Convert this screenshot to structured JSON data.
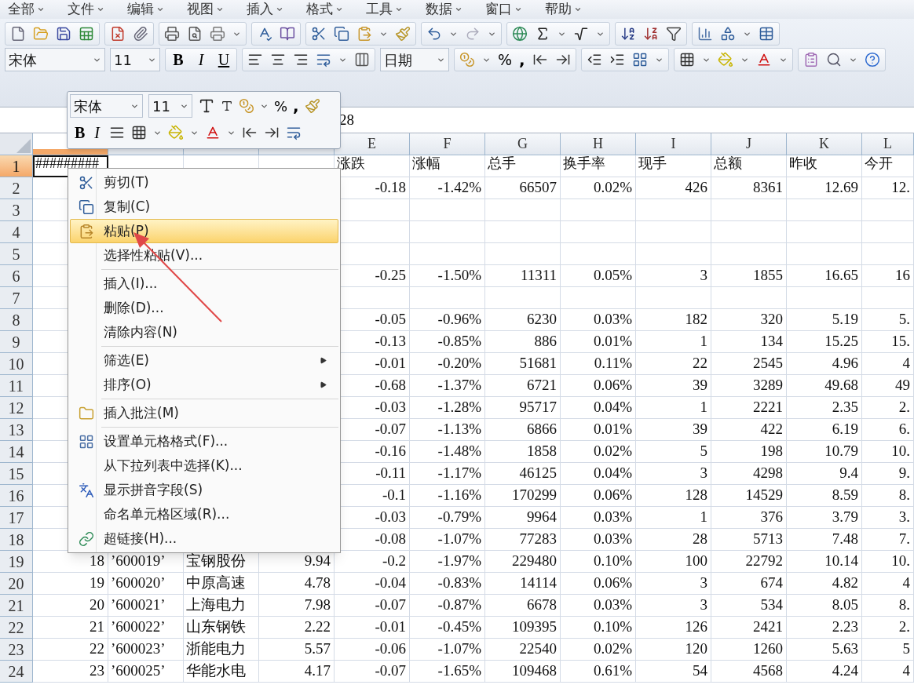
{
  "menu_bar": [
    {
      "label": "全部"
    },
    {
      "label": "文件"
    },
    {
      "label": "编辑"
    },
    {
      "label": "视图"
    },
    {
      "label": "插入"
    },
    {
      "label": "格式"
    },
    {
      "label": "工具"
    },
    {
      "label": "数据"
    },
    {
      "label": "窗口"
    },
    {
      "label": "帮助"
    }
  ],
  "toolbar": {
    "font": "宋体",
    "size": "11",
    "bold": "B",
    "italic": "I",
    "underline": "U",
    "number_format": "日期",
    "percent": "%",
    "comma": ","
  },
  "mini_toolbar": {
    "font": "宋体",
    "size": "11",
    "percent": "%",
    "comma": ",",
    "bold": "B",
    "italic": "I"
  },
  "formula_bar": {
    "value": "28"
  },
  "columns": [
    {
      "selected": true
    },
    {
      "selected": false
    },
    {
      "selected": false
    },
    {
      "selected": false
    },
    {
      "label": "E",
      "selected": false
    },
    {
      "label": "F",
      "selected": false
    },
    {
      "label": "G",
      "selected": false
    },
    {
      "label": "H",
      "selected": false
    },
    {
      "label": "I",
      "selected": false
    },
    {
      "label": "J",
      "selected": false
    },
    {
      "label": "K",
      "selected": false
    },
    {
      "label": "L",
      "selected": false
    }
  ],
  "rows": [
    {
      "number": "1",
      "kind": "header",
      "selected": true,
      "cells": {
        "A": "#########",
        "E": "涨跌",
        "F": "涨幅",
        "G": "总手",
        "H": "换手率",
        "I": "现手",
        "J": "总额",
        "K": "昨收",
        "L": "今开"
      }
    },
    {
      "number": "2",
      "kind": "data",
      "selected": false,
      "cells": {
        "E": "-0.18",
        "F": "-1.42%",
        "G": "66507",
        "H": "0.02%",
        "I": "426",
        "J": "8361",
        "K": "12.69",
        "L": "12."
      }
    },
    {
      "number": "3",
      "kind": "data",
      "selected": false
    },
    {
      "number": "4",
      "kind": "data",
      "selected": false
    },
    {
      "number": "5",
      "kind": "data",
      "selected": false
    },
    {
      "number": "6",
      "kind": "data",
      "selected": false,
      "cells": {
        "E": "-0.25",
        "F": "-1.50%",
        "G": "11311",
        "H": "0.05%",
        "I": "3",
        "J": "1855",
        "K": "16.65",
        "L": "16"
      }
    },
    {
      "number": "7",
      "kind": "data",
      "selected": false
    },
    {
      "number": "8",
      "kind": "data",
      "selected": false,
      "cells": {
        "E": "-0.05",
        "F": "-0.96%",
        "G": "6230",
        "H": "0.03%",
        "I": "182",
        "J": "320",
        "K": "5.19",
        "L": "5."
      }
    },
    {
      "number": "9",
      "kind": "data",
      "selected": false,
      "cells": {
        "E": "-0.13",
        "F": "-0.85%",
        "G": "886",
        "H": "0.01%",
        "I": "1",
        "J": "134",
        "K": "15.25",
        "L": "15."
      }
    },
    {
      "number": "10",
      "kind": "data",
      "selected": false,
      "cells": {
        "E": "-0.01",
        "F": "-0.20%",
        "G": "51681",
        "H": "0.11%",
        "I": "22",
        "J": "2545",
        "K": "4.96",
        "L": "4"
      }
    },
    {
      "number": "11",
      "kind": "data",
      "selected": false,
      "cells": {
        "E": "-0.68",
        "F": "-1.37%",
        "G": "6721",
        "H": "0.06%",
        "I": "39",
        "J": "3289",
        "K": "49.68",
        "L": "49"
      }
    },
    {
      "number": "12",
      "kind": "data",
      "selected": false,
      "cells": {
        "E": "-0.03",
        "F": "-1.28%",
        "G": "95717",
        "H": "0.04%",
        "I": "1",
        "J": "2221",
        "K": "2.35",
        "L": "2."
      }
    },
    {
      "number": "13",
      "kind": "data",
      "selected": false,
      "cells": {
        "E": "-0.07",
        "F": "-1.13%",
        "G": "6866",
        "H": "0.01%",
        "I": "39",
        "J": "422",
        "K": "6.19",
        "L": "6."
      }
    },
    {
      "number": "14",
      "kind": "data",
      "selected": false,
      "cells": {
        "E": "-0.16",
        "F": "-1.48%",
        "G": "1858",
        "H": "0.02%",
        "I": "5",
        "J": "198",
        "K": "10.79",
        "L": "10."
      }
    },
    {
      "number": "15",
      "kind": "data",
      "selected": false,
      "cells": {
        "E": "-0.11",
        "F": "-1.17%",
        "G": "46125",
        "H": "0.04%",
        "I": "3",
        "J": "4298",
        "K": "9.4",
        "L": "9."
      }
    },
    {
      "number": "16",
      "kind": "data",
      "selected": false,
      "cells": {
        "E": "-0.1",
        "F": "-1.16%",
        "G": "170299",
        "H": "0.06%",
        "I": "128",
        "J": "14529",
        "K": "8.59",
        "L": "8."
      }
    },
    {
      "number": "17",
      "kind": "data",
      "selected": false,
      "cells": {
        "E": "-0.03",
        "F": "-0.79%",
        "G": "9964",
        "H": "0.03%",
        "I": "1",
        "J": "376",
        "K": "3.79",
        "L": "3."
      }
    },
    {
      "number": "18",
      "kind": "data",
      "selected": false,
      "cells": {
        "E": "-0.08",
        "F": "-1.07%",
        "G": "77283",
        "H": "0.03%",
        "I": "28",
        "J": "5713",
        "K": "7.48",
        "L": "7."
      }
    },
    {
      "number": "19",
      "kind": "data",
      "selected": false,
      "cells": {
        "A": "18",
        "B": "’600019’",
        "C": "宝钢股份",
        "D": "9.94",
        "E": "-0.2",
        "F": "-1.97%",
        "G": "229480",
        "H": "0.10%",
        "I": "100",
        "J": "22792",
        "K": "10.14",
        "L": "10."
      }
    },
    {
      "number": "20",
      "kind": "data",
      "selected": false,
      "cells": {
        "A": "19",
        "B": "’600020’",
        "C": "中原高速",
        "D": "4.78",
        "E": "-0.04",
        "F": "-0.83%",
        "G": "14114",
        "H": "0.06%",
        "I": "3",
        "J": "674",
        "K": "4.82",
        "L": "4"
      }
    },
    {
      "number": "21",
      "kind": "data",
      "selected": false,
      "cells": {
        "A": "20",
        "B": "’600021’",
        "C": "上海电力",
        "D": "7.98",
        "E": "-0.07",
        "F": "-0.87%",
        "G": "6678",
        "H": "0.03%",
        "I": "3",
        "J": "534",
        "K": "8.05",
        "L": "8."
      }
    },
    {
      "number": "22",
      "kind": "data",
      "selected": false,
      "cells": {
        "A": "21",
        "B": "’600022’",
        "C": "山东钢铁",
        "D": "2.22",
        "E": "-0.01",
        "F": "-0.45%",
        "G": "109395",
        "H": "0.10%",
        "I": "126",
        "J": "2421",
        "K": "2.23",
        "L": "2."
      }
    },
    {
      "number": "23",
      "kind": "data",
      "selected": false,
      "cells": {
        "A": "22",
        "B": "’600023’",
        "C": "浙能电力",
        "D": "5.57",
        "E": "-0.06",
        "F": "-1.07%",
        "G": "22540",
        "H": "0.02%",
        "I": "120",
        "J": "1260",
        "K": "5.63",
        "L": "5"
      }
    },
    {
      "number": "24",
      "kind": "data",
      "selected": false,
      "cells": {
        "A": "23",
        "B": "’600025’",
        "C": "华能水电",
        "D": "4.17",
        "E": "-0.07",
        "F": "-1.65%",
        "G": "109468",
        "H": "0.61%",
        "I": "54",
        "J": "4568",
        "K": "4.24",
        "L": "4"
      }
    }
  ],
  "context_menu": [
    {
      "kind": "item",
      "label": "剪切(T)",
      "selected": false
    },
    {
      "kind": "item",
      "label": "复制(C)",
      "selected": false
    },
    {
      "kind": "item",
      "label": "粘贴(P)",
      "selected": true
    },
    {
      "kind": "item",
      "label": "选择性粘贴(V)...",
      "selected": false
    },
    {
      "kind": "separator"
    },
    {
      "kind": "item",
      "label": "插入(I)...",
      "selected": false
    },
    {
      "kind": "item",
      "label": "删除(D)...",
      "selected": false
    },
    {
      "kind": "item",
      "label": "清除内容(N)",
      "selected": false
    },
    {
      "kind": "separator"
    },
    {
      "kind": "submenu",
      "label": "筛选(E)",
      "selected": false
    },
    {
      "kind": "submenu",
      "label": "排序(O)",
      "selected": false
    },
    {
      "kind": "separator"
    },
    {
      "kind": "item",
      "label": "插入批注(M)",
      "selected": false
    },
    {
      "kind": "separator"
    },
    {
      "kind": "item",
      "label": "设置单元格格式(F)...",
      "selected": false
    },
    {
      "kind": "item",
      "label": "从下拉列表中选择(K)...",
      "selected": false
    },
    {
      "kind": "item",
      "label": "显示拼音字段(S)",
      "selected": false
    },
    {
      "kind": "item",
      "label": "命名单元格区域(R)...",
      "selected": false
    },
    {
      "kind": "item",
      "label": "超链接(H)...",
      "selected": false
    }
  ]
}
